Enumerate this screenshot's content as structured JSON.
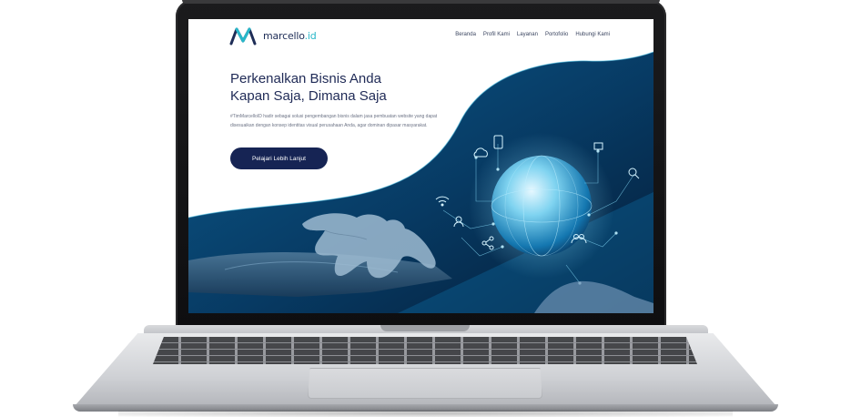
{
  "site": {
    "logo_text": "marcello",
    "logo_suffix": ".id"
  },
  "nav": {
    "items": [
      {
        "label": "Beranda"
      },
      {
        "label": "Profil Kami"
      },
      {
        "label": "Layanan"
      },
      {
        "label": "Portofolio"
      },
      {
        "label": "Hubungi Kami"
      }
    ]
  },
  "hero": {
    "title_line1": "Perkenalkan Bisnis Anda",
    "title_line2": "Kapan Saja, Dimana Saja",
    "description": "#TimMarcelloID hadir sebagai solusi pengembangan bisnis dalam jasa pembuatan website yang dapat disesuaikan dengan konsep identitas visual perusahaan Anda, agar dominan dipasar masyarakat.",
    "cta_label": "Pelajari Lebih Lanjut"
  },
  "colors": {
    "brand_navy": "#162454",
    "brand_teal": "#27b7c9",
    "hero_blue": "#0a4a78"
  }
}
